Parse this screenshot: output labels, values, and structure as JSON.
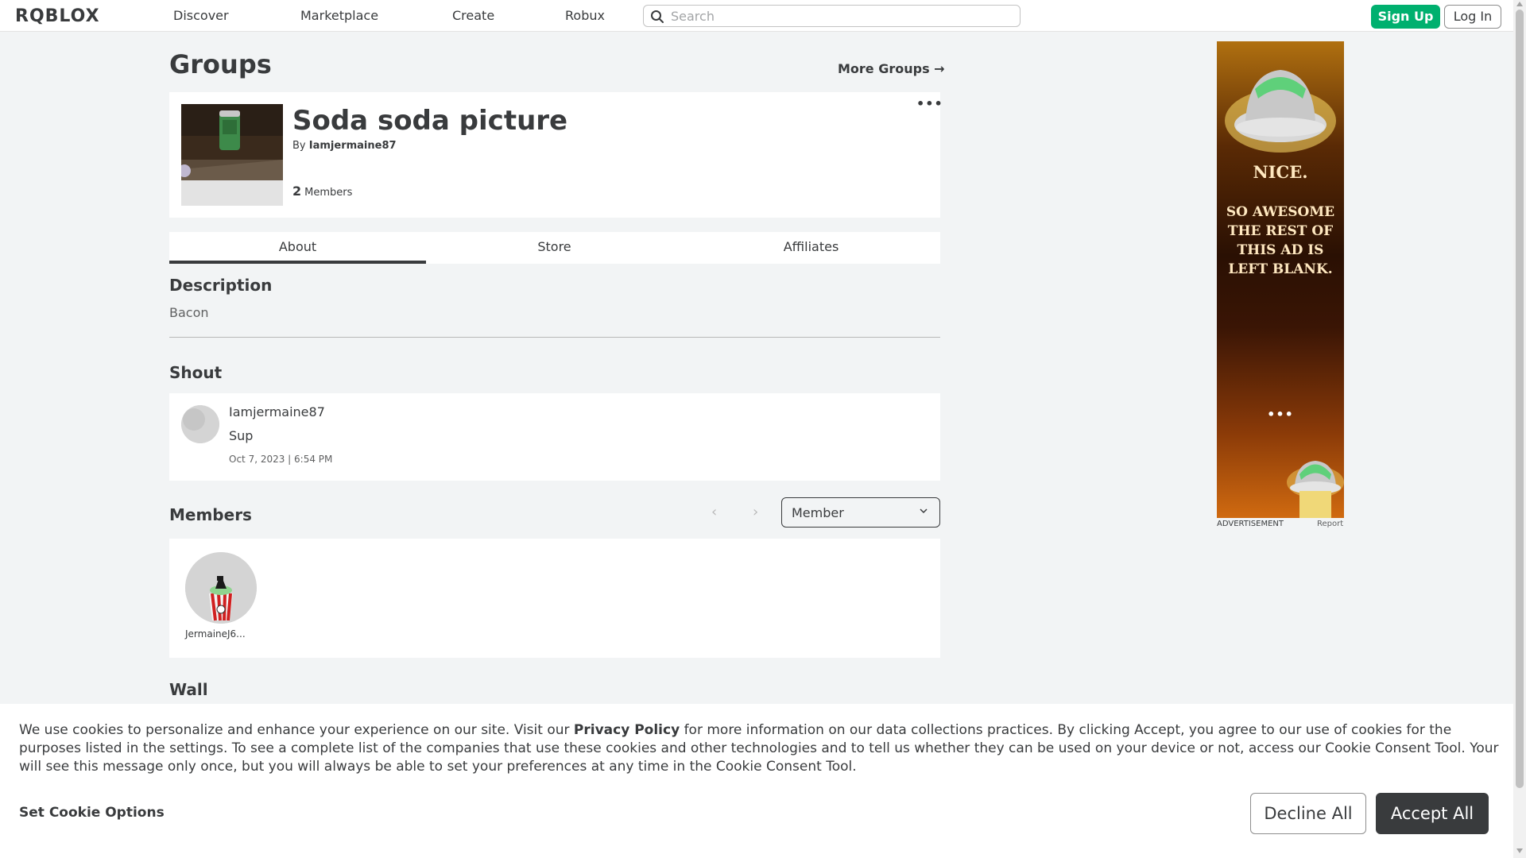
{
  "nav": {
    "logo": "RQBLOX",
    "links": [
      "Discover",
      "Marketplace",
      "Create",
      "Robux"
    ],
    "search_placeholder": "Search",
    "signup": "Sign Up",
    "login": "Log In"
  },
  "page": {
    "title": "Groups",
    "more_groups": "More Groups →"
  },
  "group": {
    "name": "Soda soda picture",
    "by_prefix": "By",
    "owner": "Iamjermaine87",
    "member_count": "2",
    "member_label": "Members",
    "more_menu": "•••"
  },
  "tabs": [
    "About",
    "Store",
    "Affiliates"
  ],
  "about": {
    "description_title": "Description",
    "description": "Bacon",
    "shout_title": "Shout",
    "shout": {
      "user": "Iamjermaine87",
      "body": "Sup",
      "time": "Oct 7, 2023 | 6:54 PM"
    },
    "members_title": "Members",
    "pager_prev": "‹",
    "pager_next": "›",
    "role_selected": "Member",
    "members": [
      {
        "name": "JermaineJ6..."
      }
    ],
    "wall_title": "Wall"
  },
  "ad": {
    "nice": "Nice.",
    "body": "So Awesome the rest of this ad is left blank.",
    "dots": "•••",
    "label": "ADVERTISEMENT",
    "report": "Report"
  },
  "cookie": {
    "text_before": "We use cookies to personalize and enhance your experience on our site. Visit our ",
    "privacy_link": "Privacy Policy",
    "text_after": " for more information on our data collections practices. By clicking Accept, you agree to our use of cookies for the purposes listed in the settings. To see a complete list of the companies that use these cookies and other technologies and to tell us whether they can be used on your device or not, access our Cookie Consent Tool. Your will see this message only once, but you will always be able to set your preferences at any time in the Cookie Consent Tool.",
    "set_options": "Set Cookie Options",
    "decline": "Decline All",
    "accept": "Accept All"
  },
  "colors": {
    "accent_green": "#00b06f",
    "text_dark": "#393b3d",
    "page_bg": "#f2f4f5"
  }
}
